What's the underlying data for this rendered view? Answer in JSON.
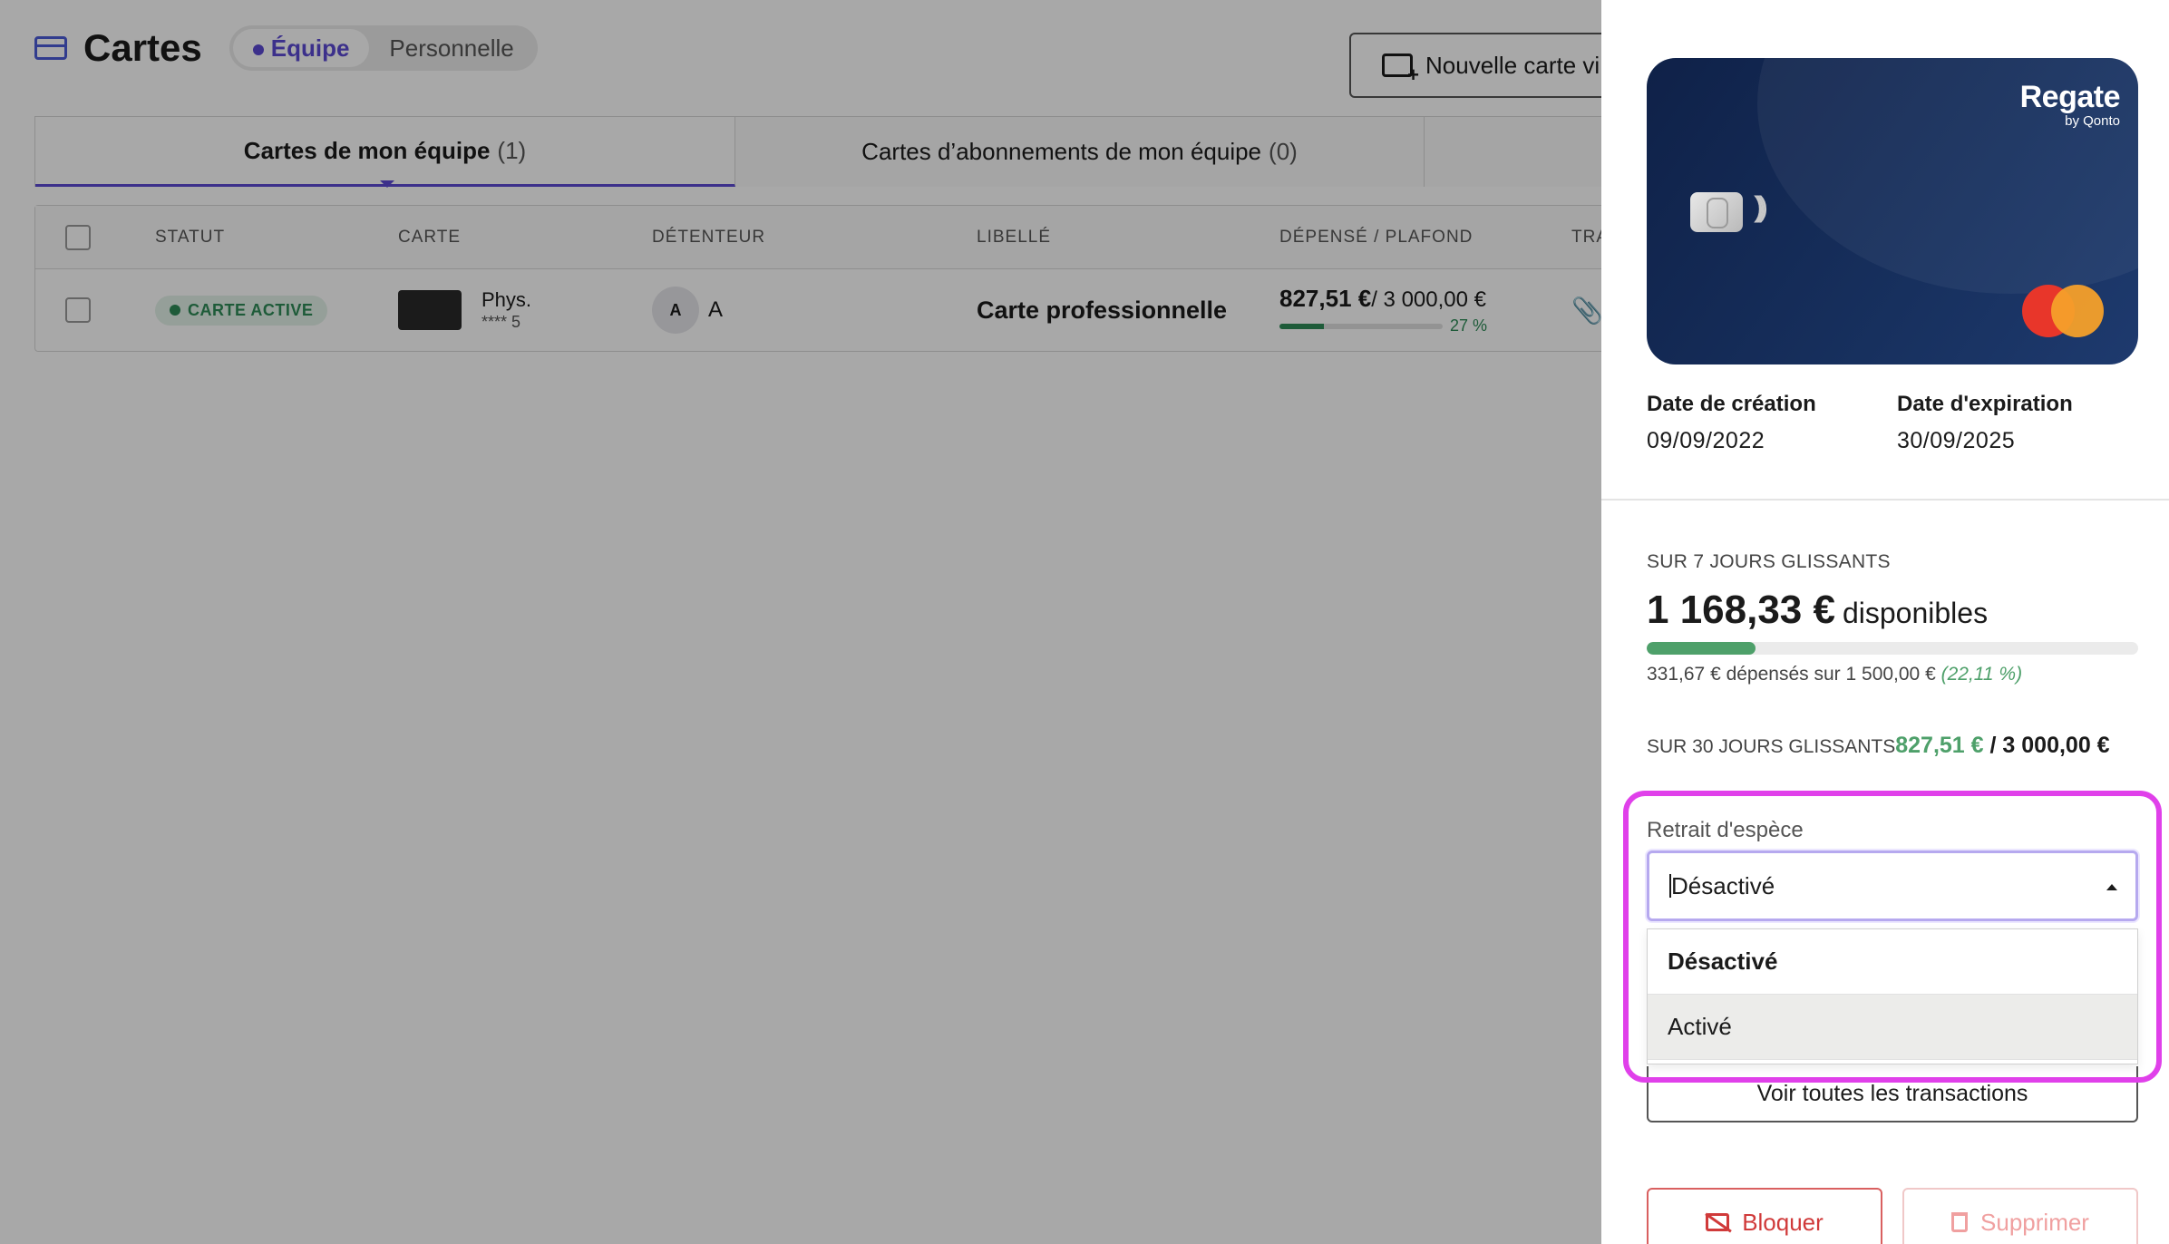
{
  "header": {
    "title": "Cartes",
    "toggle": {
      "team": "Équipe",
      "personal": "Personnelle"
    },
    "new_card_button": "Nouvelle carte vi"
  },
  "tabs": [
    {
      "label": "Cartes de mon équipe",
      "count": "(1)"
    },
    {
      "label": "Cartes d’abonnements de mon équipe",
      "count": "(0)"
    }
  ],
  "table": {
    "columns": [
      "STATUT",
      "CARTE",
      "DÉTENTEUR",
      "LIBELLÉ",
      "DÉPENSÉ / PLAFOND",
      "TRA"
    ],
    "row": {
      "status": "CARTE ACTIVE",
      "card_type": "Phys.",
      "card_number": "**** 5",
      "holder_initial": "A",
      "holder_name": "A",
      "label": "Carte professionnelle",
      "spent": "827,51 €",
      "limit": "/ 3 000,00 €",
      "progress_percent": 27,
      "progress_label": "27 %"
    }
  },
  "panel": {
    "card": {
      "brand": "Regate",
      "brand_sub": "by Qonto"
    },
    "creation_date_label": "Date de création",
    "creation_date": "09/09/2022",
    "expiration_date_label": "Date d'expiration",
    "expiration_date": "30/09/2025",
    "limit_7_days": {
      "title": "SUR 7 JOURS GLISSANTS",
      "available_amount": "1 168,33 €",
      "available_word": "disponibles",
      "progress_percent": 22.11,
      "detail": "331,67 € dépensés sur  1 500,00 €",
      "detail_pct": "(22,11 %)"
    },
    "limit_30_days": {
      "title": "SUR 30 JOURS GLISSANTS",
      "spent": "827,51 €",
      "separator": " / ",
      "total": "3 000,00 €"
    },
    "cash_withdrawal": {
      "label": "Retrait d'espèce",
      "selected": "Désactivé",
      "options": [
        "Désactivé",
        "Activé"
      ]
    },
    "all_transactions_button": "Voir toutes les transactions",
    "block_button": "Bloquer",
    "delete_button": "Supprimer"
  }
}
